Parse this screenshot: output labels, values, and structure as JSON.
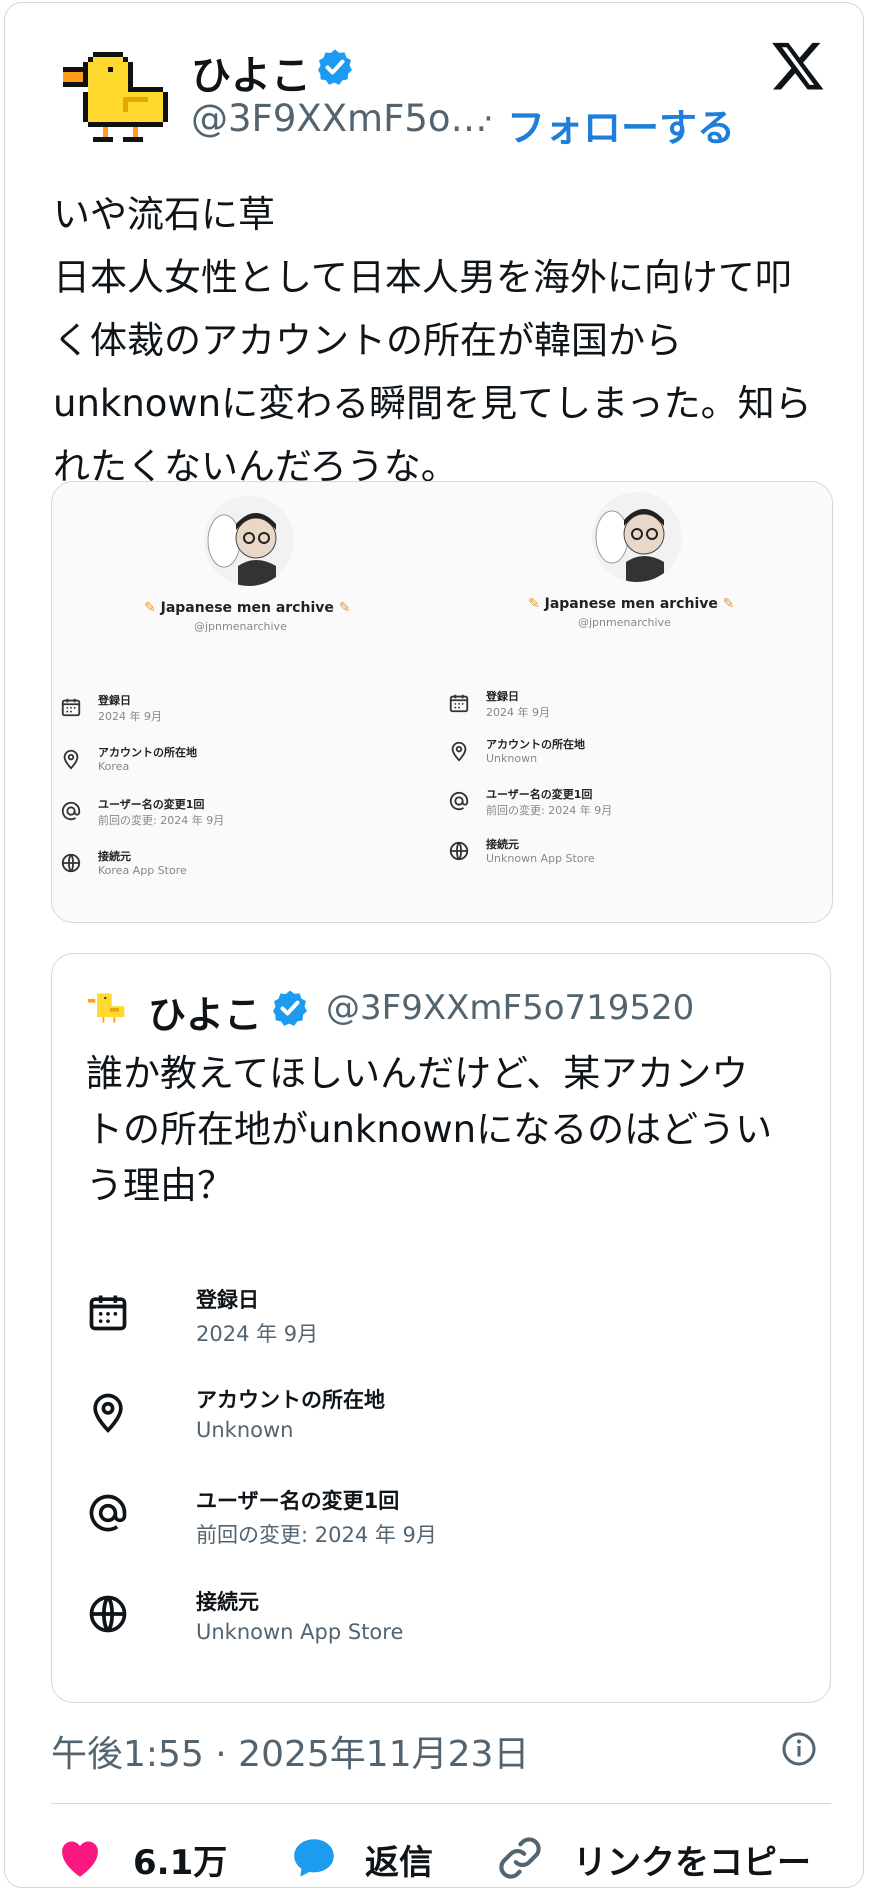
{
  "post": {
    "author_name": "ひよこ",
    "author_handle": "@3F9XXmF5o…",
    "separator": "·",
    "follow_label": "フォローする",
    "text": "いや流石に草\n日本人女性として日本人男を海外に向けて叩\nく体裁のアカウントの所在が韓国から\nunknownに変わる瞬間を見てしまった。知ら\nれたくないんだろうな。",
    "timestamp": "午後1:55 · 2025年11月23日"
  },
  "media": {
    "left": {
      "name": "Japanese men archive",
      "handle": "@jpnmenarchive",
      "rows": [
        {
          "label": "登録日",
          "value": "2024 年 9月"
        },
        {
          "label": "アカウントの所在地",
          "value": "Korea"
        },
        {
          "label": "ユーザー名の変更1回",
          "value": "前回の変更: 2024 年 9月"
        },
        {
          "label": "接続元",
          "value": "Korea App Store"
        }
      ]
    },
    "right": {
      "name": "Japanese men archive",
      "handle": "@jpnmenarchive",
      "rows": [
        {
          "label": "登録日",
          "value": "2024 年 9月"
        },
        {
          "label": "アカウントの所在地",
          "value": "Unknown"
        },
        {
          "label": "ユーザー名の変更1回",
          "value": "前回の変更: 2024 年 9月"
        },
        {
          "label": "接続元",
          "value": "Unknown App Store"
        }
      ]
    }
  },
  "quote": {
    "author_name": "ひよこ",
    "author_handle": "@3F9XXmF5o719520",
    "text": "誰か教えてほしいんだけど、某アカンウ\nトの所在地がunknownになるのはどうい\nう理由？",
    "rows": [
      {
        "label": "登録日",
        "value": "2024 年 9月"
      },
      {
        "label": "アカウントの所在地",
        "value": "Unknown"
      },
      {
        "label": "ユーザー名の変更1回",
        "value": "前回の変更: 2024 年 9月"
      },
      {
        "label": "接続元",
        "value": "Unknown App Store"
      }
    ]
  },
  "actions": {
    "likes": "6.1万",
    "reply": "返信",
    "copy_link": "リンクをコピー"
  },
  "colors": {
    "verified": "#1d9bf0",
    "follow": "#1d7fd8",
    "like": "#f91880",
    "reply": "#1d9bf0"
  }
}
